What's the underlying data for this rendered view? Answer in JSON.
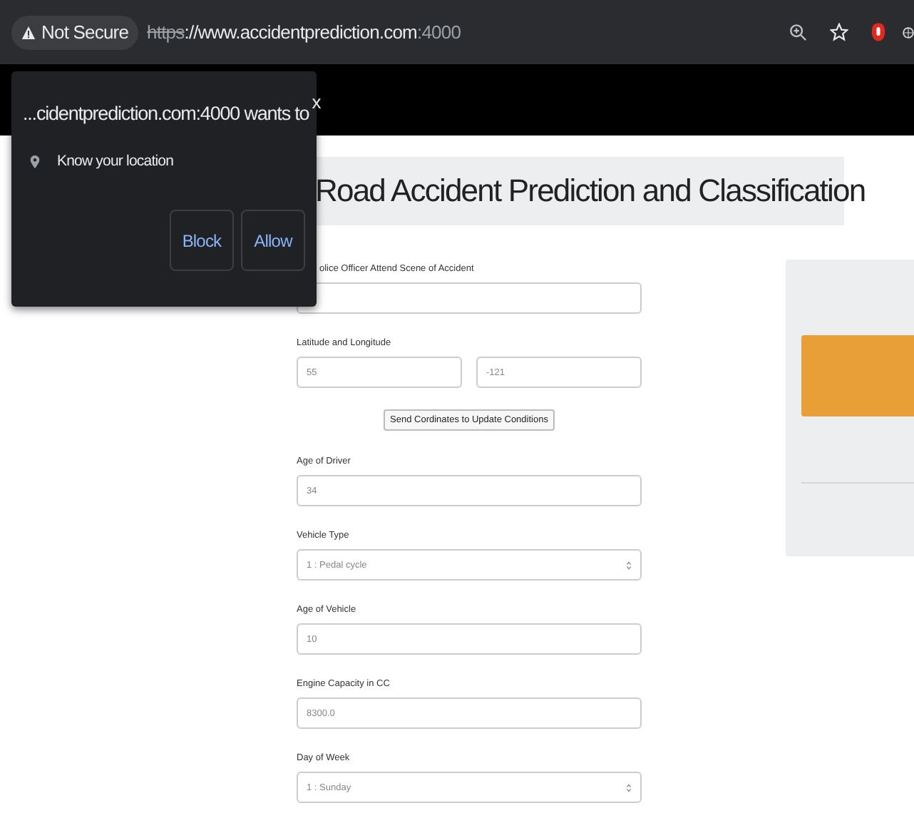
{
  "browser": {
    "security": "Not Secure",
    "url_scheme": "https",
    "url_host": "://www.accidentprediction.com",
    "url_port": ":4000"
  },
  "permission_popup": {
    "title": "...cidentprediction.com:4000 wants to",
    "close": "x",
    "request": "Know your location",
    "buttons": [
      "Block",
      "Allow"
    ]
  },
  "page": {
    "title": "Road Accident Prediction and Classification",
    "fields": [
      {
        "kind": "input",
        "label": "olice Officer Attend Scene of Accident"
      },
      {
        "kind": "pair",
        "label": "Latitude and Longitude",
        "values": [
          "55",
          "-121"
        ]
      },
      {
        "kind": "button",
        "text": "Send Cordinates to Update Conditions"
      },
      {
        "kind": "input",
        "label": "Age of Driver",
        "value": "34"
      },
      {
        "kind": "select",
        "label": "Vehicle Type",
        "value": "1 : Pedal cycle"
      },
      {
        "kind": "input",
        "label": "Age of Vehicle",
        "value": "10"
      },
      {
        "kind": "input",
        "label": "Engine Capacity in CC",
        "value": "8300.0"
      },
      {
        "kind": "select",
        "label": "Day of Week",
        "value": "1 : Sunday"
      }
    ]
  }
}
